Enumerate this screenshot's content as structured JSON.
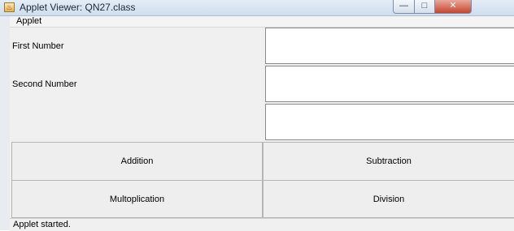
{
  "window": {
    "title": "Applet Viewer: QN27.class",
    "minimize_glyph": "—",
    "maximize_glyph": "□",
    "close_glyph": "✕"
  },
  "menu": {
    "applet_label": "Applet"
  },
  "form": {
    "first_label": "First Number",
    "second_label": "Second Number",
    "first_value": "",
    "second_value": "",
    "result_value": ""
  },
  "buttons": {
    "addition": "Addition",
    "subtraction": "Subtraction",
    "multiplication": "Multoplication",
    "division": "Division"
  },
  "status": {
    "text": "Applet started."
  }
}
